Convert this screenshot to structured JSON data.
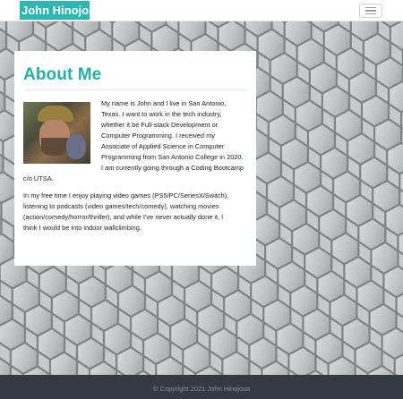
{
  "navbar": {
    "brand": "John Hinojosa",
    "toggle_icon": "hamburger-menu-icon",
    "brand_color": "#2fb6b2"
  },
  "about": {
    "title": "About Me",
    "title_color": "#23b0ab",
    "photo_alt": "John Hinojosa photo",
    "paragraph1": "My name is John and I live in San Antonio, Texas. I want to work in the tech industry, whether it be Full-stack Development or Computer Programming. I received my Associate of Applied Science in Computer Programming from San Antonio College in 2020. I am currently going through a Coding Bootcamp c/o UTSA.",
    "paragraph2": "In my free time I enjoy playing video games (PS5/PC/SeriesX/Switch), listening to podcasts (video games/tech/comedy), watching movies (action/comedy/horror/thriller), and while I've never actually done it, I think I would be into indoor wallclimbing."
  },
  "footer": {
    "text": "© Copyright 2021 John Hinojosa",
    "background": "#343a40"
  }
}
